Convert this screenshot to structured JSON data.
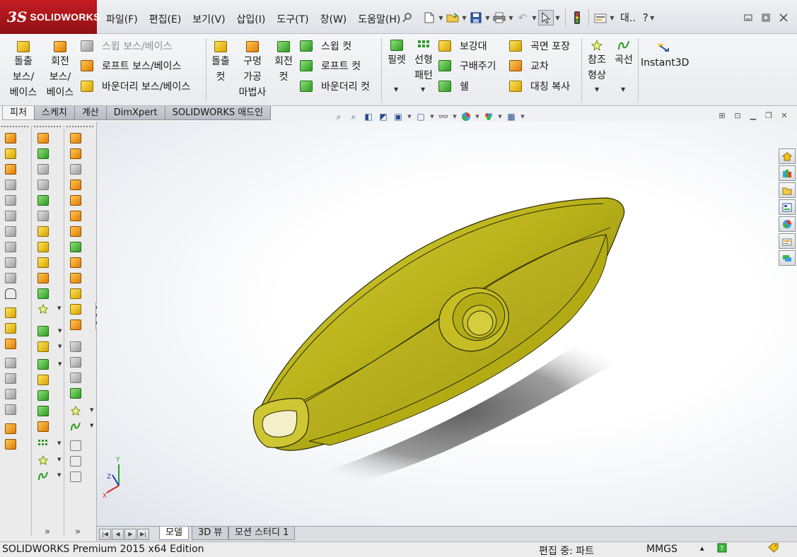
{
  "app": {
    "logo_ds": "3S",
    "logo_text": "SOLIDWORKS"
  },
  "menus": [
    "파일(F)",
    "편집(E)",
    "보기(V)",
    "삽입(I)",
    "도구(T)",
    "창(W)",
    "도움말(H)"
  ],
  "titlebar": {
    "search_label": "대..",
    "help_label": "?"
  },
  "ribbon": {
    "extrude_boss": "돌출\n보스/\n베이스",
    "revolve_boss": "회전\n보스/\n베이스",
    "sweep_boss": "스윕 보스/베이스",
    "loft_boss": "로프트 보스/베이스",
    "boundary_boss": "바운더리 보스/베이스",
    "extrude_cut": "돌출\n컷",
    "hole_wizard": "구멍\n가공\n마법사",
    "revolve_cut": "회전\n컷",
    "sweep_cut": "스윕 컷",
    "loft_cut": "로프트 컷",
    "boundary_cut": "바운더리 컷",
    "fillet": "필렛",
    "linear_pattern": "선형\n패턴",
    "rib": "보강대",
    "draft": "구배주기",
    "shell": "쉘",
    "wrap": "곡면 포장",
    "intersect": "교차",
    "mirror": "대칭 복사",
    "ref_geometry": "참조\n형상",
    "curves": "곡선",
    "instant3d": "Instant3D"
  },
  "tabs": [
    "피처",
    "스케치",
    "계산",
    "DimXpert",
    "SOLIDWORKS 애드인"
  ],
  "active_tab": "피처",
  "bottom_tabs": [
    "모델",
    "3D 뷰",
    "모션 스터디 1"
  ],
  "statusbar": {
    "edition": "SOLIDWORKS Premium 2015 x64 Edition",
    "mode": "편집 중: 파트",
    "units": "MMGS",
    "up_arrow": "▴"
  },
  "triad": {
    "x": "X",
    "y": "Y",
    "z": "Z"
  },
  "icons": {
    "new": "new-document-icon",
    "open": "open-folder-icon",
    "save": "save-icon",
    "print": "print-icon",
    "undo": "undo-icon",
    "select": "select-arrow-icon",
    "rebuild": "traffic-light-icon",
    "options": "options-icon"
  },
  "colors": {
    "part_body": "#b9b21a",
    "logo_red": "#b3181d",
    "viewport_edge": "#dfe3ea"
  }
}
